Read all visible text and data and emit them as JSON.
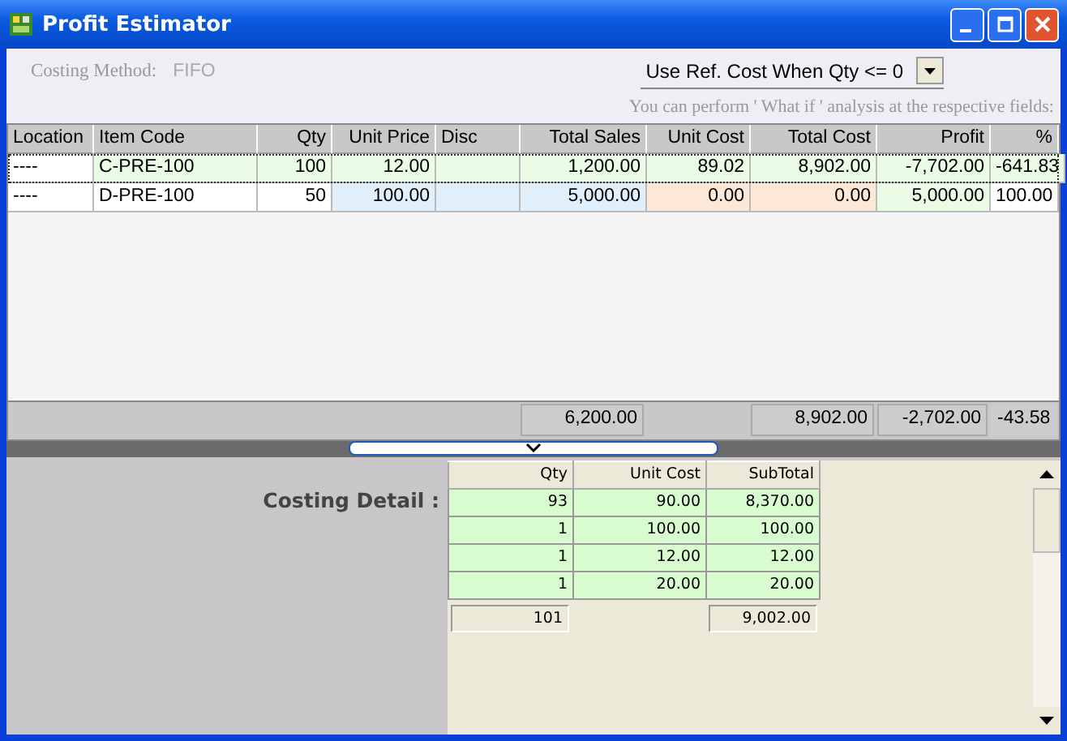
{
  "window": {
    "title": "Profit Estimator"
  },
  "costing_method": {
    "label": "Costing Method:",
    "value": "FIFO"
  },
  "ref_cost_dropdown": {
    "value": "Use Ref. Cost When Qty <= 0"
  },
  "hint": "You can perform ' What if ' analysis at the respective fields:",
  "table": {
    "columns": [
      {
        "label": "Location",
        "kind": "label"
      },
      {
        "label": "Item Code",
        "kind": "text"
      },
      {
        "label": "Qty",
        "kind": "number"
      },
      {
        "label": "Unit Price",
        "kind": "entry"
      },
      {
        "label": "Disc",
        "kind": "entry_text"
      },
      {
        "label": "Total Sales",
        "kind": "entry",
        "total": "6,200.00"
      },
      {
        "label": "Unit Cost",
        "kind": "cost"
      },
      {
        "label": "Total Cost",
        "kind": "cost",
        "total": "8,902.00"
      },
      {
        "label": "Profit",
        "kind": "result",
        "total": "-2,702.00"
      },
      {
        "label": "%",
        "kind": "number",
        "total": "-43.58"
      }
    ],
    "rows": [
      {
        "selected": true,
        "cells": [
          "----",
          "C-PRE-100",
          "100",
          "12.00",
          "",
          "1,200.00",
          "89.02",
          "8,902.00",
          "-7,702.00",
          "-641.83"
        ]
      },
      {
        "selected": false,
        "cells": [
          "----",
          "D-PRE-100",
          "50",
          "100.00",
          "",
          "5,000.00",
          "0.00",
          "0.00",
          "5,000.00",
          "100.00"
        ]
      }
    ]
  },
  "costing_detail_label": "Costing Detail :",
  "costing_detail": {
    "columns": [
      {
        "label": "Qty"
      },
      {
        "label": "Unit Cost"
      },
      {
        "label": "SubTotal"
      }
    ],
    "totals": {
      "qty": "101",
      "subtotal": "9,002.00"
    },
    "rows": [
      [
        "93",
        "90.00",
        "8,370.00"
      ],
      [
        "1",
        "100.00",
        "100.00"
      ],
      [
        "1",
        "12.00",
        "12.00"
      ],
      [
        "1",
        "20.00",
        "20.00"
      ]
    ]
  }
}
